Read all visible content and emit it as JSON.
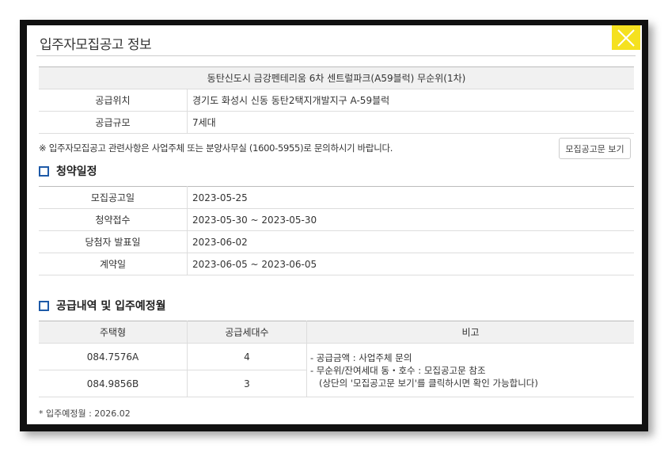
{
  "dialog": {
    "title": "입주자모집공고 정보",
    "close_icon": "close-icon",
    "accent_color": "#f5e11f"
  },
  "complex": {
    "name": "동탄신도시 금강펜테리움 6차 센트럴파크(A59블럭) 무순위(1차)",
    "rows": [
      {
        "label": "공급위치",
        "value": "경기도 화성시 신동 동탄2택지개발지구 A-59블럭"
      },
      {
        "label": "공급규모",
        "value": "7세대"
      }
    ]
  },
  "notice": {
    "text": "※ 입주자모집공고 관련사항은 사업주체 또는 분양사무실 (1600-5955)로 문의하시기 바랍니다.",
    "button_label": "모집공고문 보기"
  },
  "schedule": {
    "title": "청약일정",
    "rows": [
      {
        "label": "모집공고일",
        "value": "2023-05-25"
      },
      {
        "label": "청약접수",
        "value": "2023-05-30 ~ 2023-05-30"
      },
      {
        "label": "당첨자 발표일",
        "value": "2023-06-02"
      },
      {
        "label": "계약일",
        "value": "2023-06-05 ~ 2023-06-05"
      }
    ]
  },
  "supply": {
    "title": "공급내역 및 입주예정월",
    "headers": [
      "주택형",
      "공급세대수",
      "비고"
    ],
    "rows": [
      {
        "type": "084.7576A",
        "units": "4"
      },
      {
        "type": "084.9856B",
        "units": "3"
      }
    ],
    "notes": [
      "-  공급금액 : 사업주체 문의",
      "-  무순위/잔여세대 동・호수 : 모집공고문 참조",
      "   (상단의 '모집공고문 보기'를 클릭하시면 확인 가능합니다)"
    ]
  },
  "footnote": "* 입주예정월 : 2026.02"
}
